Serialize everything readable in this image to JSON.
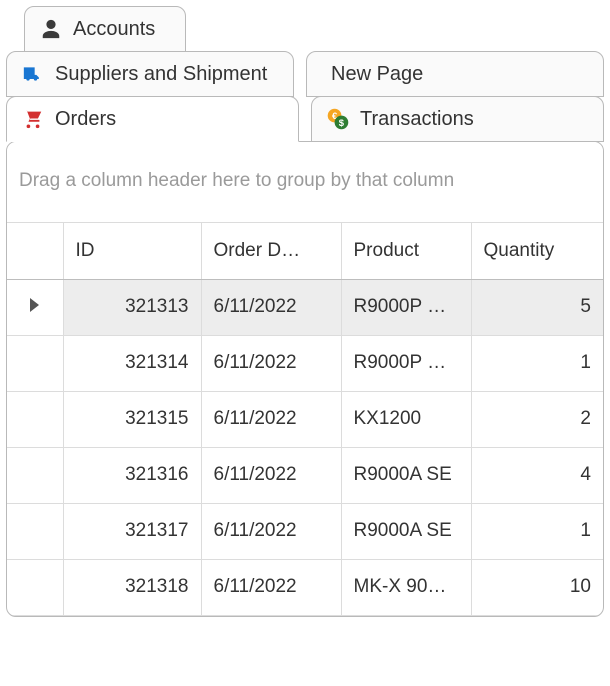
{
  "tabs": {
    "accounts": "Accounts",
    "suppliers": "Suppliers and Shipment",
    "newpage": "New Page",
    "orders": "Orders",
    "transactions": "Transactions"
  },
  "grid": {
    "group_hint": "Drag a column header here to group by that column",
    "columns": {
      "id": "ID",
      "order_date": "Order D…",
      "product": "Product",
      "quantity": "Quantity"
    },
    "rows": [
      {
        "id": "321313",
        "date": "6/11/2022",
        "product": "R9000P …",
        "qty": "5"
      },
      {
        "id": "321314",
        "date": "6/11/2022",
        "product": "R9000P …",
        "qty": "1"
      },
      {
        "id": "321315",
        "date": "6/11/2022",
        "product": "KX1200",
        "qty": "2"
      },
      {
        "id": "321316",
        "date": "6/11/2022",
        "product": "R9000A SE",
        "qty": "4"
      },
      {
        "id": "321317",
        "date": "6/11/2022",
        "product": "R9000A SE",
        "qty": "1"
      },
      {
        "id": "321318",
        "date": "6/11/2022",
        "product": "MK-X 90…",
        "qty": "10"
      }
    ]
  }
}
